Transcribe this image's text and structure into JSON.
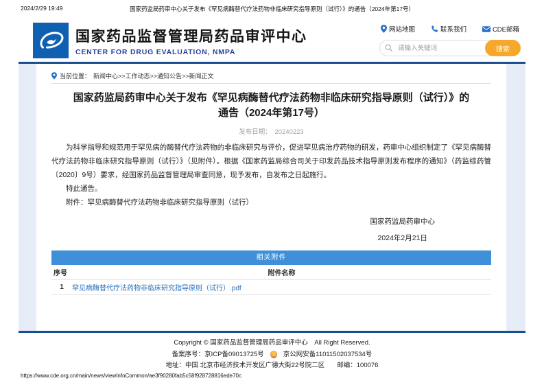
{
  "print": {
    "timestamp": "2024/2/29 19:49",
    "doc_title": "国家药监局药审中心关于发布《罕见病酶替代疗法药物非临床研究指导原则（试行）》的通告（2024年第17号）",
    "url": "https://www.cde.org.cn/main/news/viewInfoCommon/ae3f90280fab5c58f928728816ede70c"
  },
  "header": {
    "org_name_cn": "国家药品监督管理局药品审评中心",
    "org_name_en": "CENTER FOR DRUG EVALUATION, NMPA",
    "logo_icon": "cde-bird-swoosh-logo",
    "links": [
      {
        "icon": "map-pin-icon",
        "label": "网站地图"
      },
      {
        "icon": "phone-icon",
        "label": "联系我们"
      },
      {
        "icon": "mail-icon",
        "label": "CDE邮箱"
      }
    ],
    "search": {
      "icon": "search-icon",
      "placeholder": "请输入关键词",
      "button_label": "搜索"
    }
  },
  "breadcrumb": {
    "icon": "map-pin-icon",
    "prefix": "当前位置：",
    "path": "新闻中心>>工作动态>>通知公告>>新闻正文"
  },
  "article": {
    "title": "国家药监局药审中心关于发布《罕见病酶替代疗法药物非临床研究指导原则（试行）》的通告（2024年第17号）",
    "publish_date_label": "发布日期：",
    "publish_date": "20240223",
    "paragraphs": [
      "为科学指导和规范用于罕见病的酶替代疗法药物的非临床研究与评价，促进罕见病治疗药物的研发，药审中心组织制定了《罕见病酶替代疗法药物非临床研究指导原则（试行）》（见附件）。根据《国家药监局综合司关于印发药品技术指导原则发布程序的通知》（药监综药管〔2020〕9号）要求，经国家药品监督管理局审查同意，现予发布，自发布之日起施行。",
      "特此通告。",
      "附件：罕见病酶替代疗法药物非临床研究指导原则（试行）"
    ],
    "signature": {
      "org": "国家药监局药审中心",
      "date": "2024年2月21日"
    }
  },
  "attachments": {
    "title": "相关附件",
    "columns": {
      "index": "序号",
      "name": "附件名称"
    },
    "rows": [
      {
        "index": "1",
        "name": "罕见病酶替代疗法药物非临床研究指导原则（试行）.pdf"
      }
    ]
  },
  "footer": {
    "copyright": "Copyright © 国家药品监督管理局药品审评中心　All Right Reserved.",
    "icp": "备案序号：京ICP备09013725号",
    "police_icon": "police-badge-icon",
    "police": "京公网安备11011502037534号",
    "address": "地址：中国 北京市经济技术开发区广德大街22号院二区",
    "postcode": "邮编：100076"
  },
  "colors": {
    "primary_blue": "#1b4e8f",
    "table_header_blue": "#4090d9",
    "link_blue": "#2970b8",
    "accent_orange": "#f7a82b",
    "page_background": "#e7edf8",
    "org_en_blue": "#2c3f9d"
  }
}
